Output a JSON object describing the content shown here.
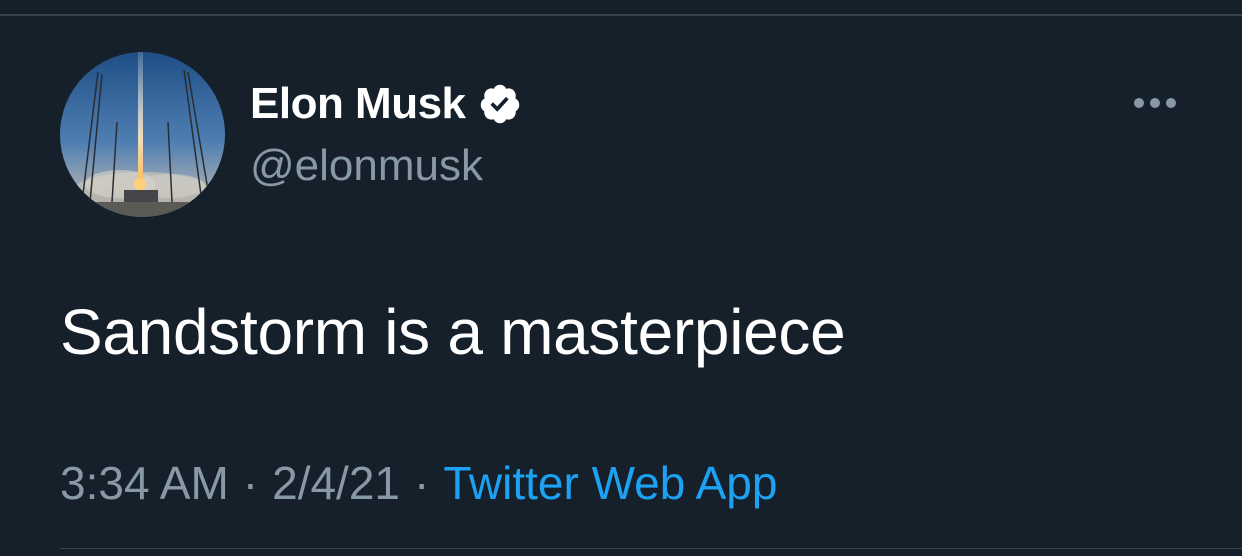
{
  "tweet": {
    "author": {
      "display_name": "Elon Musk",
      "handle": "@elonmusk",
      "verified": true,
      "avatar_icon": "rocket-launch-avatar"
    },
    "text": "Sandstorm is a masterpiece",
    "meta": {
      "time": "3:34 AM",
      "separator": "·",
      "date": "2/4/21",
      "source": "Twitter Web App"
    },
    "more_icon": "more-horizontal-icon"
  },
  "colors": {
    "background": "#15202b",
    "primary_text": "#ffffff",
    "secondary_text": "#8899a6",
    "link": "#1da1f2",
    "divider": "#38444d"
  }
}
